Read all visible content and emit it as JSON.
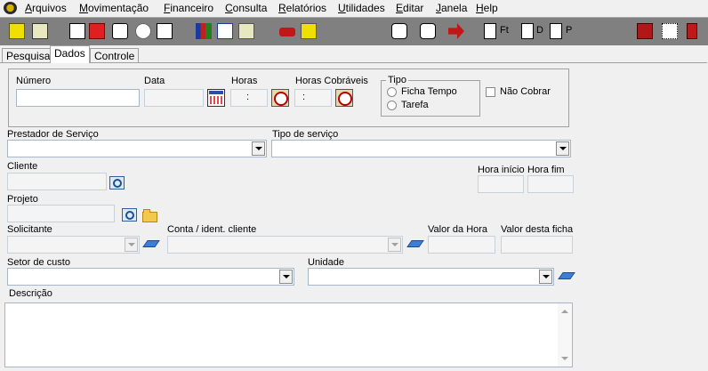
{
  "menu": [
    "Arquivos",
    "Movimentação",
    "Financeiro",
    "Consulta",
    "Relatórios",
    "Utilidades",
    "Editar",
    "Janela",
    "Help"
  ],
  "toolbar": {
    "label_ft": "Ft",
    "label_d": "D",
    "label_p": "P"
  },
  "tabs": [
    "Pesquisa",
    "Dados",
    "Controle"
  ],
  "form": {
    "numero_label": "Número",
    "data_label": "Data",
    "horas_label": "Horas",
    "horas_value": ":",
    "horas_cobraveis_label": "Horas Cobráveis",
    "horas_cobraveis_value": ":",
    "tipo_label": "Tipo",
    "tipo_options": [
      "Ficha Tempo",
      "Tarefa"
    ],
    "nao_cobrar_label": "Não Cobrar",
    "prestador_label": "Prestador de Serviço",
    "tipo_servico_label": "Tipo de serviço",
    "cliente_label": "Cliente",
    "hora_inicio_label": "Hora início",
    "hora_fim_label": "Hora fim",
    "projeto_label": "Projeto",
    "solicitante_label": "Solicitante",
    "conta_label": "Conta / ident. cliente",
    "valor_hora_label": "Valor da Hora",
    "valor_ficha_label": "Valor desta ficha",
    "setor_label": "Setor de custo",
    "unidade_label": "Unidade",
    "descricao_label": "Descrição"
  },
  "icons": {
    "app": "app-logo-icon",
    "calendar": "calendar-icon",
    "alarm": "alarm-clock-icon",
    "search": "search-icon",
    "folder": "folder-icon",
    "eraser": "eraser-icon"
  }
}
